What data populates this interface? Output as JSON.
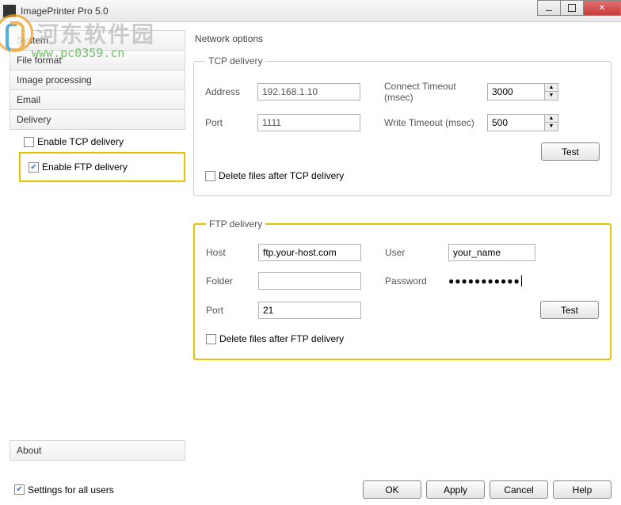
{
  "window": {
    "title": "ImagePrinter Pro 5.0"
  },
  "watermark": {
    "text": "河东软件园",
    "url": "www.pc0359.cn"
  },
  "sidebar": {
    "items": [
      "System",
      "File format",
      "Image processing",
      "Email",
      "Delivery"
    ],
    "delivery_children": {
      "tcp": {
        "label": "Enable TCP delivery",
        "checked": false
      },
      "ftp": {
        "label": "Enable FTP delivery",
        "checked": true
      }
    },
    "about": "About"
  },
  "main": {
    "heading": "Network options",
    "tcp": {
      "legend": "TCP delivery",
      "address_label": "Address",
      "address_value": "192.168.1.10",
      "port_label": "Port",
      "port_value": "1111",
      "connect_timeout_label": "Connect Timeout (msec)",
      "connect_timeout_value": "3000",
      "write_timeout_label": "Write Timeout (msec)",
      "write_timeout_value": "500",
      "test": "Test",
      "delete_after": "Delete files after TCP delivery",
      "delete_after_checked": false
    },
    "ftp": {
      "legend": "FTP delivery",
      "host_label": "Host",
      "host_value": "ftp.your-host.com",
      "folder_label": "Folder",
      "folder_value": "",
      "port_label": "Port",
      "port_value": "21",
      "user_label": "User",
      "user_value": "your_name",
      "password_label": "Password",
      "password_value": "●●●●●●●●●●●",
      "test": "Test",
      "delete_after": "Delete files after FTP delivery",
      "delete_after_checked": false
    }
  },
  "footer": {
    "settings_all_users": "Settings for all users",
    "settings_all_users_checked": true,
    "ok": "OK",
    "apply": "Apply",
    "cancel": "Cancel",
    "help": "Help"
  }
}
